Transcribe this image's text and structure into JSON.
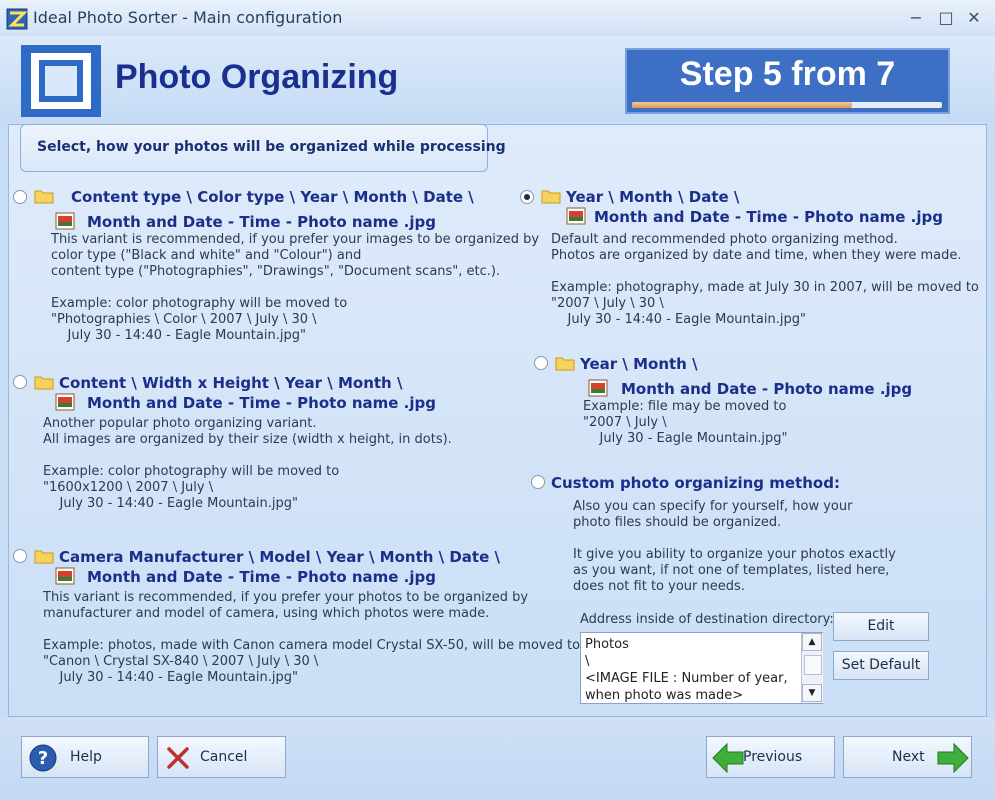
{
  "window": {
    "title": "Ideal Photo Sorter - Main configuration",
    "minimize_glyph": "−",
    "maximize_glyph": "□",
    "close_glyph": "✕"
  },
  "header": {
    "title": "Photo Organizing",
    "step_label": "Step 5 from 7",
    "step_progress": 0.71
  },
  "panel": {
    "subtitle": "Select, how your photos will be organized while processing"
  },
  "options": {
    "content_type": {
      "path": "Content type \\ Color type \\ Year \\ Month \\ Date \\",
      "file": "Month and Date - Time - Photo name .jpg",
      "description": "This variant is recommended, if you prefer your images to be organized by\ncolor type (\"Black and white\" and \"Colour\") and\ncontent type (\"Photographies\", \"Drawings\", \"Document scans\", etc.).\n\nExample: color photography will be moved to\n\"Photographies \\ Color \\ 2007 \\ July \\ 30 \\\n    July 30 - 14:40 - Eagle Mountain.jpg\"",
      "selected": false
    },
    "content_size": {
      "path": "Content \\ Width x Height \\ Year \\ Month \\",
      "file": "Month and Date - Time - Photo name .jpg",
      "description": "Another popular photo organizing variant.\nAll images are organized by their size (width x height, in dots).\n\nExample: color photography will be moved to\n\"1600x1200 \\ 2007 \\ July \\\n    July 30 - 14:40 - Eagle Mountain.jpg\"",
      "selected": false
    },
    "camera": {
      "path": "Camera Manufacturer \\ Model \\ Year \\ Month \\ Date \\",
      "file": "Month and Date - Time - Photo name .jpg",
      "description": "This variant is recommended, if you prefer your photos to be organized by\nmanufacturer and model of camera, using which photos were made.\n\nExample: photos, made with Canon camera model Crystal SX-50, will be moved to\n\"Canon \\ Crystal SX-840 \\ 2007 \\ July \\ 30 \\\n    July 30 - 14:40 - Eagle Mountain.jpg\"",
      "selected": false
    },
    "year_month_date": {
      "path": "Year \\ Month \\ Date \\",
      "file": "Month and Date - Time - Photo name .jpg",
      "description": "Default and recommended photo organizing method.\nPhotos are organized by date and time, when they were made.\n\nExample: photography, made at July 30 in 2007, will be moved to\n\"2007 \\ July \\ 30 \\\n    July 30 - 14:40 - Eagle Mountain.jpg\"",
      "selected": true
    },
    "year_month": {
      "path": "Year \\ Month \\",
      "file": "Month and Date - Photo name .jpg",
      "description": "Example: file may be moved to\n\"2007 \\ July \\\n    July 30 - Eagle Mountain.jpg\"",
      "selected": false
    },
    "custom": {
      "label": "Custom photo organizing method:",
      "description": "Also you can specify for yourself, how your\nphoto files should be organized.\n\nIt give you ability to organize your photos exactly\nas you want, if not one of templates, listed here,\ndoes not fit to your needs.",
      "selected": false
    }
  },
  "address": {
    "label": "Address inside of destination directory:",
    "value": "Photos\n\\\n<IMAGE FILE : Number of year,\nwhen photo was made>",
    "edit_label": "Edit",
    "set_default_label": "Set Default"
  },
  "footer": {
    "help_label": "Help",
    "cancel_label": "Cancel",
    "previous_label": "Previous",
    "next_label": "Next"
  },
  "colors": {
    "accent": "#1b2f8a",
    "step_box": "#3d6fc4",
    "help_icon": "#2a5db0",
    "cancel_icon": "#c0302a",
    "arrow_icon": "#3fae3a"
  },
  "icons": [
    "app-icon",
    "logo-icon",
    "folder-icon",
    "image-file-icon",
    "help-icon",
    "cancel-icon",
    "left-arrow-icon",
    "right-arrow-icon",
    "scroll-up-icon",
    "scroll-down-icon"
  ]
}
